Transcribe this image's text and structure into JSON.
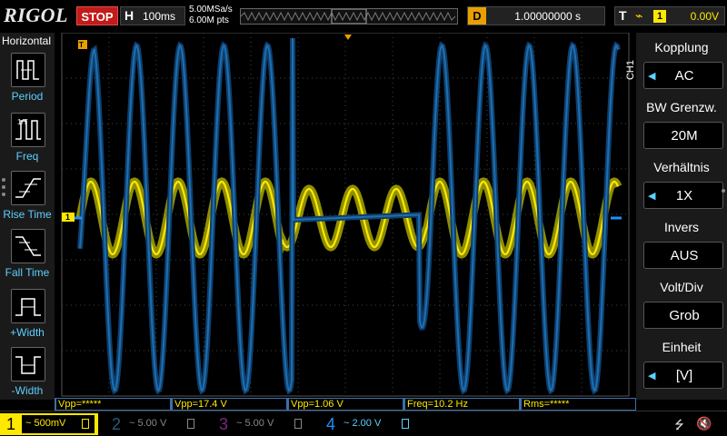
{
  "topbar": {
    "brand": "RIGOL",
    "run_state": "STOP",
    "timebase_label": "H",
    "timebase_value": "100ms",
    "sample_rate": "5.00MSa/s",
    "mem_depth": "6.00M pts",
    "delay_label": "D",
    "delay_value": "1.00000000 s",
    "trigger_label": "T",
    "trigger_source": "1",
    "trigger_level": "0.00V"
  },
  "left_menu": {
    "title": "Horizontal",
    "items": [
      {
        "label": "Period",
        "icon": "period-icon"
      },
      {
        "label": "Freq",
        "icon": "freq-icon"
      },
      {
        "label": "Rise Time",
        "icon": "rise-time-icon"
      },
      {
        "label": "Fall Time",
        "icon": "fall-time-icon"
      },
      {
        "label": "+Width",
        "icon": "pos-width-icon"
      },
      {
        "label": "-Width",
        "icon": "neg-width-icon"
      }
    ]
  },
  "right_menu": {
    "channel_tag": "CH1",
    "items": [
      {
        "title": "Kopplung",
        "value": "AC",
        "has_arrow": true
      },
      {
        "title": "BW Grenzw.",
        "value": "20M",
        "has_arrow": false
      },
      {
        "title": "Verhältnis",
        "value": "1X",
        "has_arrow": true
      },
      {
        "title": "Invers",
        "value": "AUS",
        "has_arrow": false
      },
      {
        "title": "Volt/Div",
        "value": "Grob",
        "has_arrow": false
      },
      {
        "title": "Einheit",
        "value": "[V]",
        "has_arrow": true
      }
    ]
  },
  "measurements": [
    {
      "label": "Vpp=*****"
    },
    {
      "label": "Vpp=17.4 V"
    },
    {
      "label": "Vpp=1.06 V"
    },
    {
      "label": "Freq=10.2 Hz"
    },
    {
      "label": "Rms=*****"
    }
  ],
  "channels": [
    {
      "num": "1",
      "value": "~ 500mV",
      "color": "#ffe800"
    },
    {
      "num": "2",
      "value": "~ 5.00 V",
      "color": "#1e6fb0"
    },
    {
      "num": "3",
      "value": "~ 5.00 V",
      "color": "#c43cc4"
    },
    {
      "num": "4",
      "value": "~ 2.00 V",
      "color": "#1e8fff"
    }
  ],
  "markers": {
    "ch1_marker": "1",
    "trigger_pos_marker": "T"
  },
  "colors": {
    "ch1": "#ffe800",
    "ch2": "#1e6fb0",
    "accent_blue": "#5dd0ff",
    "stop_red": "#c31a1a",
    "delay_orange": "#e8a000"
  },
  "icons": {
    "usb": "usb-icon",
    "speaker_muted": "speaker-muted-icon"
  }
}
